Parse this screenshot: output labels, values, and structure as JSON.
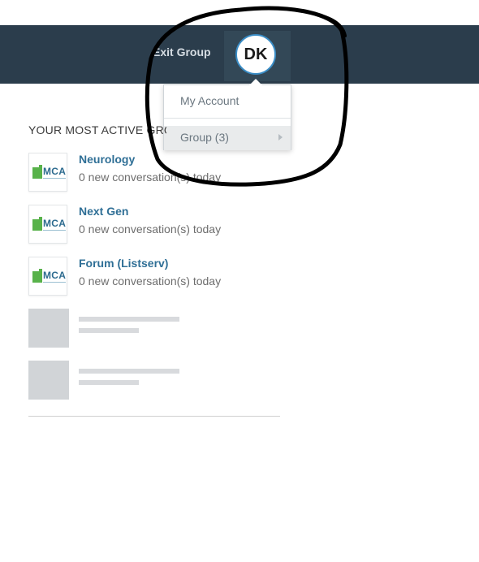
{
  "header": {
    "exit_group_label": "Exit Group",
    "avatar_initials": "DK"
  },
  "dropdown": {
    "items": [
      {
        "label": "My Account"
      },
      {
        "label": "Group (3)"
      }
    ]
  },
  "active_groups": {
    "title": "YOUR MOST ACTIVE GROUPS",
    "logo_text": "MCA",
    "groups": [
      {
        "name": "Neurology",
        "conversations": "0 new conversation(s) today"
      },
      {
        "name": "Next Gen",
        "conversations": "0 new conversation(s) today"
      },
      {
        "name": "Forum (Listserv)",
        "conversations": "0 new conversation(s) today"
      }
    ]
  },
  "colors": {
    "topbar": "#2b3d4c",
    "link": "#2f6f96",
    "logo_green": "#58b24a",
    "annotation": "#000000"
  }
}
